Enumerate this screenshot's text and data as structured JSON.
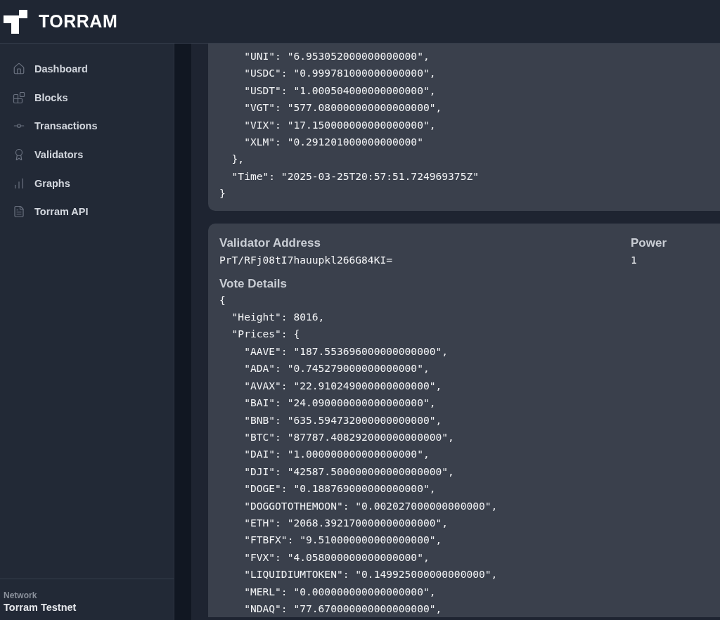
{
  "header": {
    "brand": "TORRAM"
  },
  "sidebar": {
    "items": [
      {
        "label": "Dashboard",
        "selected": false
      },
      {
        "label": "Blocks",
        "selected": false
      },
      {
        "label": "Transactions",
        "selected": false
      },
      {
        "label": "Validators",
        "selected": false
      },
      {
        "label": "Graphs",
        "selected": false
      },
      {
        "label": "Torram API",
        "selected": false
      }
    ],
    "network_label": "Network",
    "network": "Torram Testnet"
  },
  "votes": [
    {
      "lines": [
        "    \"UNI\": \"6.953052000000000000\",",
        "    \"USDC\": \"0.999781000000000000\",",
        "    \"USDT\": \"1.000504000000000000\",",
        "    \"VGT\": \"577.080000000000000000\",",
        "    \"VIX\": \"17.150000000000000000\",",
        "    \"XLM\": \"0.291201000000000000\"",
        "  },",
        "  \"Time\": \"2025-03-25T20:57:51.724969375Z\"",
        "}"
      ]
    },
    {
      "address_label": "Validator Address",
      "address": "PrT/RFj08tI7hauupkl266G84KI=",
      "power_label": "Power",
      "power": "1",
      "details_label": "Vote Details",
      "lines": [
        "{",
        "  \"Height\": 8016,",
        "  \"Prices\": {",
        "    \"AAVE\": \"187.553696000000000000\",",
        "    \"ADA\": \"0.745279000000000000\",",
        "    \"AVAX\": \"22.910249000000000000\",",
        "    \"BAI\": \"24.090000000000000000\",",
        "    \"BNB\": \"635.594732000000000000\",",
        "    \"BTC\": \"87787.408292000000000000\",",
        "    \"DAI\": \"1.000000000000000000\",",
        "    \"DJI\": \"42587.500000000000000000\",",
        "    \"DOGE\": \"0.188769000000000000\",",
        "    \"DOGGOTOTHEMOON\": \"0.002027000000000000\",",
        "    \"ETH\": \"2068.392170000000000000\",",
        "    \"FTBFX\": \"9.510000000000000000\",",
        "    \"FVX\": \"4.058000000000000000\",",
        "    \"LIQUIDIUMTOKEN\": \"0.149925000000000000\",",
        "    \"MERL\": \"0.000000000000000000\",",
        "    \"NDAQ\": \"77.670000000000000000\","
      ]
    }
  ]
}
